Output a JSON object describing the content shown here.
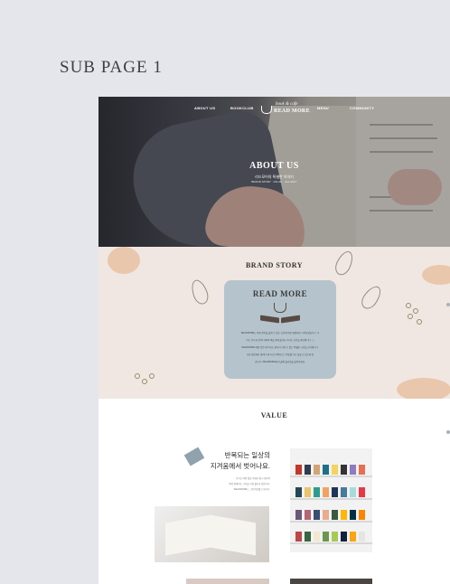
{
  "page_label": "SUB PAGE 1",
  "nav": {
    "items": [
      "ABOUT US",
      "BOOKCLUB",
      "MENU",
      "COMMUNITY"
    ],
    "logo_script": "book & cafe",
    "logo_name": "READ MORE"
  },
  "hero": {
    "title": "ABOUT US",
    "subtitle": "리드모어의 특별한 이야기",
    "caption": "BRAND STORY  ·  VALUE  ·  GALLERY"
  },
  "brand": {
    "title": "BRAND STORY",
    "card_logo": "READ MORE",
    "paragraph": [
      "READMORE는 책과 음악을 즐길 수 있는 공간에 대한 열정에서 시작되었습니다. 우",
      "리는 단지 한 잔의 커피와 책을 함께 즐겨요 속하는 공간을 제공합니다. 그",
      "READMORE 매장 음은 해 이기도 쉽게 다가갈 수 있는 특별한 시간을 선사합니다.",
      "또한 일상에서 벗어나 책 속으로 빠져드는 여유를 다시 찾을 수 있도록 돕",
      "습니다. READMORE에서 삶의 즐거움을 발견하세요."
    ]
  },
  "value": {
    "title": "VALUE",
    "heading_line1": "반복되는 일상의",
    "heading_line2": "지겨움에서 벗어나요.",
    "text": [
      "우리는 바쁜 일상 속에서 잠시 멈추어",
      "책과 함께하는 시간을 가질 필요가 있습니다.",
      "READMORE는 그런 여유를 드립니다."
    ]
  },
  "colors": {
    "page_bg": "#e4e6eb",
    "brand_bg": "#f0e7e2",
    "card_bg": "#b5c4cc",
    "accent_blob": "#e9c7ad"
  }
}
